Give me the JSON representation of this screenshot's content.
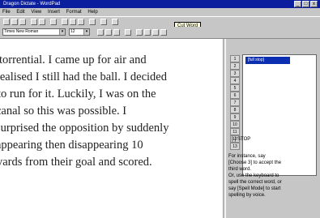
{
  "window": {
    "title": "Dragon Dictate - WordPad",
    "buttons": [
      "_",
      "□",
      "x"
    ]
  },
  "menu": {
    "items": [
      "File",
      "Edit",
      "View",
      "Insert",
      "Format",
      "Help"
    ]
  },
  "toolbar": {
    "font_combo": "Times New Roman",
    "size_combo": "12",
    "tooltip": "Cut Word"
  },
  "document": {
    "lines": [
      "torrential. I came up for air and",
      "realised I still had the ball.  I decided",
      "to run for it.  Luckily, I was on the",
      "canal so this was possible.  I",
      "surprised the opposition by suddenly",
      "appearing then disappearing 10",
      "yards from their goal and scored."
    ]
  },
  "sidebar": {
    "numbers": [
      "1",
      "2",
      "3",
      "4",
      "5",
      "6",
      "7",
      "8",
      "9",
      "10",
      "11",
      "12",
      "13"
    ],
    "selected_word": "[full stop]",
    "cancel_label": "[-]",
    "cancel_tag": "STOP",
    "help_lines": [
      "For instance, say",
      "[Choose 3] to accept the",
      "third word.",
      "Or, use the keyboard to",
      "spell the correct word, or",
      "say [Spell Mode] to start",
      "spelling by voice."
    ]
  },
  "colors": {
    "titlebar": "#0b1f9e",
    "selection": "#0b2fb0",
    "chrome": "#c6c6c6"
  }
}
